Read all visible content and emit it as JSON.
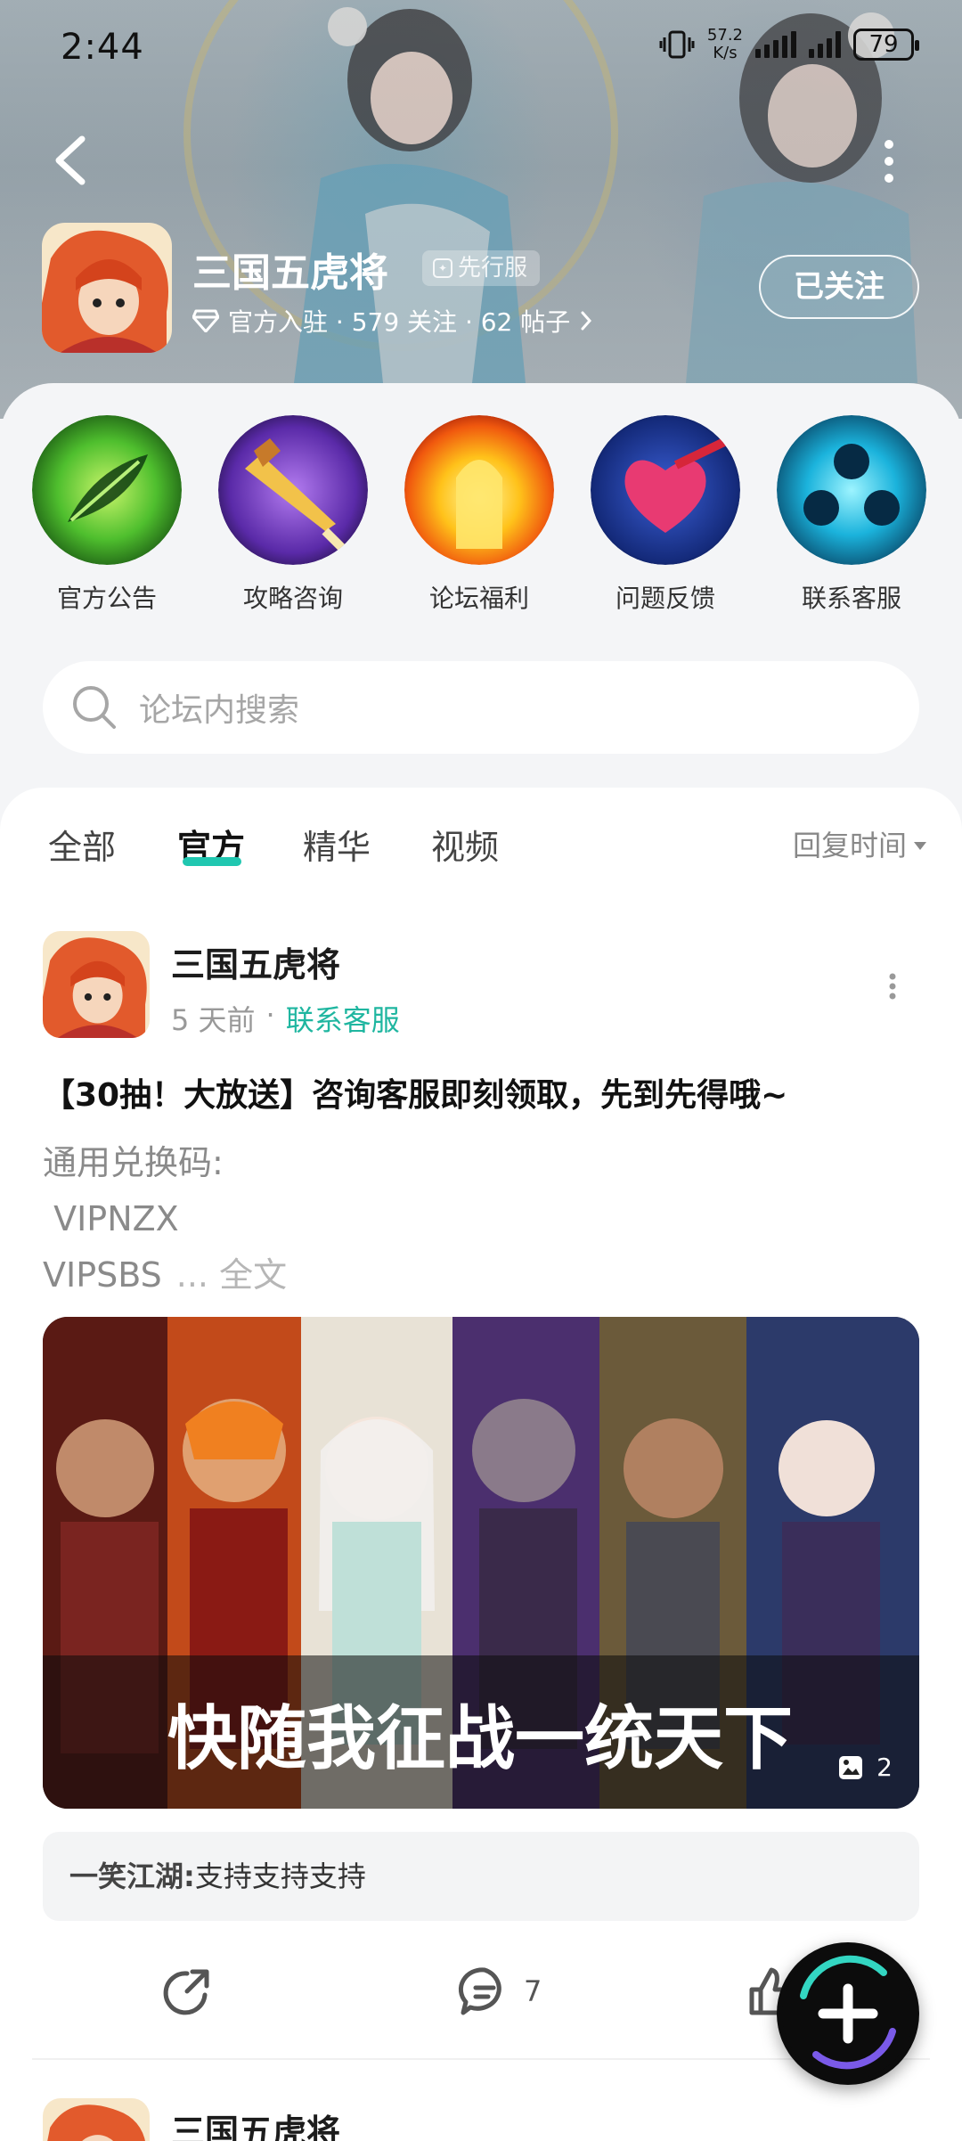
{
  "status_bar": {
    "time": "2:44",
    "net_speed_value": "57.2",
    "net_speed_unit": "K/s",
    "battery": "79"
  },
  "forum": {
    "title": "三国五虎将",
    "badge": "先行服",
    "meta": "官方入驻 · 579 关注 · 62 帖子",
    "follow_label": "已关注"
  },
  "shortcuts": [
    {
      "label": "官方公告",
      "icon": "leaf-icon"
    },
    {
      "label": "攻略咨询",
      "icon": "sword-icon"
    },
    {
      "label": "论坛福利",
      "icon": "glow-icon"
    },
    {
      "label": "问题反馈",
      "icon": "heart-icon"
    },
    {
      "label": "联系客服",
      "icon": "orb-icon"
    }
  ],
  "search": {
    "placeholder": "论坛内搜索"
  },
  "tabs": [
    {
      "label": "全部"
    },
    {
      "label": "官方"
    },
    {
      "label": "精华"
    },
    {
      "label": "视频"
    }
  ],
  "active_tab": "官方",
  "sort_label": "回复时间",
  "post": {
    "author": "三国五虎将",
    "time": "5 天前",
    "separator": "·",
    "tag": "联系客服",
    "title": "【30抽！大放送】咨询客服即刻领取，先到先得哦~",
    "body_line1": "通用兑换码:",
    "body_line2": " VIPNZX",
    "body_line3": "VIPSBS",
    "more_label": "... 全文",
    "image_caption": "快随我征战一统天下",
    "image_count": "2",
    "comment_author": "一笑江湖:",
    "comment_text": "支持支持支持",
    "comment_count": "7"
  },
  "next_post": {
    "author": "三国五虎将"
  },
  "colors": {
    "accent": "#20c7b0",
    "tag": "#1fb6a0"
  }
}
